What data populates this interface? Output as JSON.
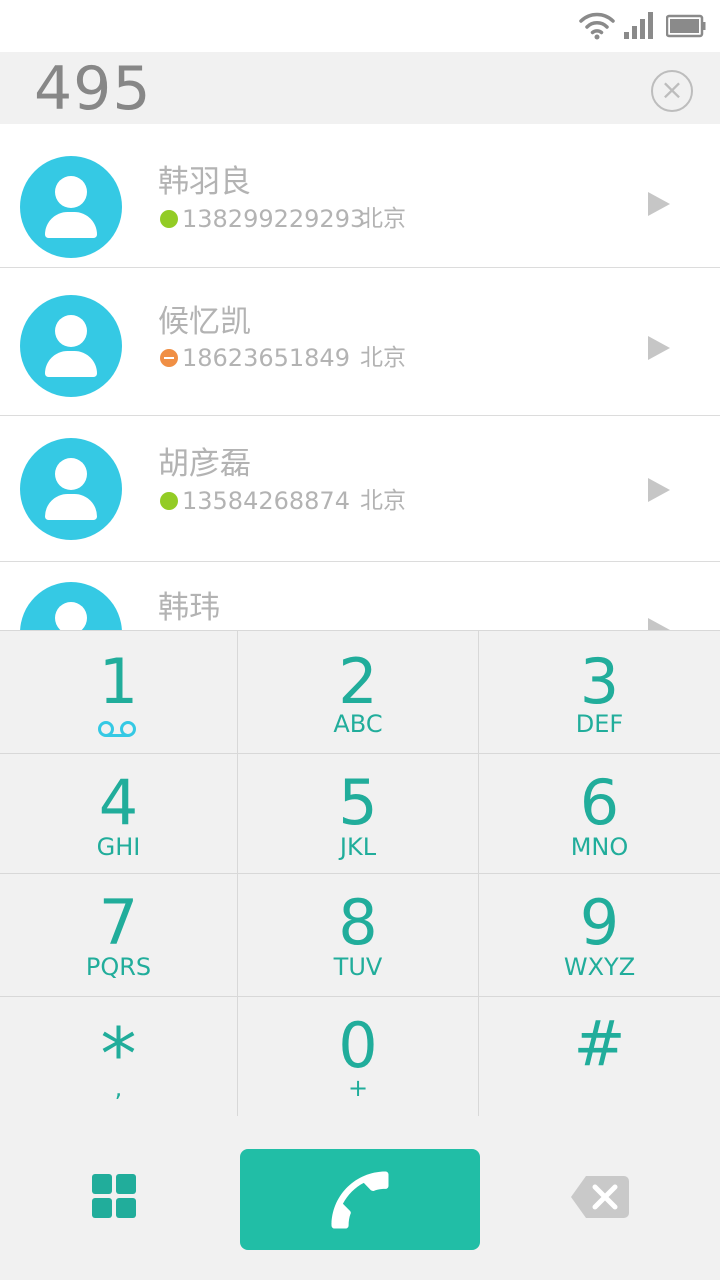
{
  "status_bar": {
    "icons": [
      "wifi-icon",
      "signal-icon",
      "battery-icon"
    ]
  },
  "dial_input": {
    "number": "495",
    "clear_icon": "close-circle-icon"
  },
  "contacts": [
    {
      "name": "韩羽良",
      "phone": "138299229293",
      "location": "北京",
      "status": "online",
      "status_color": "#93cc25"
    },
    {
      "name": "候忆凯",
      "phone": "18623651849",
      "location": "北京",
      "status": "busy",
      "status_color": "#f08f44"
    },
    {
      "name": "胡彦磊",
      "phone": "13584268874",
      "location": "北京",
      "status": "online",
      "status_color": "#93cc25"
    },
    {
      "name": "韩玮",
      "phone": "",
      "location": "",
      "status": "",
      "status_color": ""
    }
  ],
  "keypad": {
    "keys": [
      {
        "digit": "1",
        "letters": "",
        "icon": "voicemail-icon"
      },
      {
        "digit": "2",
        "letters": "ABC"
      },
      {
        "digit": "3",
        "letters": "DEF"
      },
      {
        "digit": "4",
        "letters": "GHI"
      },
      {
        "digit": "5",
        "letters": "JKL"
      },
      {
        "digit": "6",
        "letters": "MNO"
      },
      {
        "digit": "7",
        "letters": "PQRS"
      },
      {
        "digit": "8",
        "letters": "TUV"
      },
      {
        "digit": "9",
        "letters": "WXYZ"
      },
      {
        "digit": "*",
        "letters": ","
      },
      {
        "digit": "0",
        "letters": "+"
      },
      {
        "digit": "#",
        "letters": ""
      }
    ]
  },
  "actions": {
    "left_icon": "grid-icon",
    "call_icon": "phone-icon",
    "right_icon": "backspace-icon"
  },
  "colors": {
    "accent": "#21ad9b",
    "call_button": "#21bea6",
    "avatar": "#35c9e4",
    "text_muted": "#b3b3b3"
  }
}
